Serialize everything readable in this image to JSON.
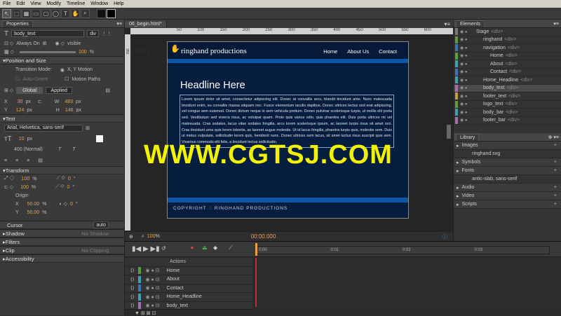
{
  "menu": [
    "File",
    "Edit",
    "View",
    "Modify",
    "Timeline",
    "Window",
    "Help"
  ],
  "properties": {
    "tab": "Properties",
    "element_name": "body_text",
    "element_tag": "div",
    "overflow": "Always On",
    "visibility": "visible",
    "opacity": "100",
    "opacity_unit": "%",
    "sections": {
      "position": "Position and Size",
      "text": "Text",
      "transform": "Transform",
      "cursor": "Cursor",
      "shadow": "Shadow",
      "filters": "Filters",
      "clip": "Clip",
      "accessibility": "Accessibility"
    },
    "transition_label": "Transition Mode:",
    "transition_xy": "X, Y Motion",
    "auto_orient": "Auto-Orient",
    "motion_paths": "Motion Paths",
    "global_tab": "Global",
    "applied_tab": "Applied",
    "x_label": "X",
    "x_val": "30",
    "x_unit": "px",
    "y_label": "Y",
    "y_val": "124",
    "y_unit": "px",
    "w_label": "W",
    "w_val": "483",
    "w_unit": "px",
    "h_label": "H",
    "h_val": "146",
    "h_unit": "px",
    "font": "Arial, Helvetica, sans-serif",
    "font_size": "10",
    "font_size_unit": "px",
    "font_weight": "400 (Normal)",
    "scale_x": "100",
    "scale_y": "100",
    "scale_unit": "%",
    "skew_x": "0",
    "skew_y": "0",
    "skew_unit": "°",
    "origin_label": "Origin",
    "origin_x": "50.00",
    "origin_y": "50.00",
    "origin_unit": "%",
    "rotate": "0",
    "cursor_value": "auto",
    "shadow_value": "No Shadow",
    "clip_value": "No Clipping"
  },
  "stage": {
    "file_tab": "06_begin.html*",
    "zoom": "100",
    "zoom_unit": "%",
    "time": "00:00.000",
    "ruler_ticks": [
      "50",
      "100",
      "150",
      "200",
      "250",
      "300",
      "350",
      "400",
      "450",
      "500",
      "550",
      "600"
    ],
    "left_ticks": [
      "50",
      "100",
      "150",
      "200",
      "250",
      "300",
      "350"
    ],
    "site": {
      "logo": "ringhand productions",
      "nav": [
        "Home",
        "About Us",
        "Contact"
      ],
      "headline": "Headline Here",
      "body": "Lorem ipsum dolor sit amet, consectetur adipiscing elit. Donec at convallis arcu, blandit tincidunt ante. Nunc malesuada tincidunt enim, eu convallis massa aliquam nec. Fusce elementum iaculis dapibus. Donec ultrices lectus sed erat adipiscing, vel congue sem euismod. Donec dictum neque in sem vehicula pretium. Donec pulvinar scelerisque turpis, ut mollis elit porta sed. Vestibulum sed viverra risus, ac volutpat quam. Proin quis varius odio, quis pharetra elit. Duis porta ultrices mi vel malesuada. Cras sodales, lacus vitae sodales fringilla, arcu lorem scelerisque ipsum, ac laoreet turpis risus sit amet orci. Cras tincidunt urna quis lorem lobortis, ac laoreet augue molestie. Ut id lacus fringilla, pharetra turpis quis, molestie sem. Duis ut metus vulputate, sollicitudin lorem quis, hendrerit nunc. Donec ultrices sem lacus, sit amet luctus risus suscipit quis sem. Vivamus commodo elit felis, a tincidunt lectus sollicitudin.",
      "copyright": "COPYRIGHT :: RINGHAND PRODUCTIONS"
    }
  },
  "elements": {
    "tab": "Elements",
    "rows": [
      {
        "label": "Stage",
        "tag": "<div>",
        "color": "#777777",
        "indent": 0
      },
      {
        "label": "ringhand",
        "tag": "<div>",
        "color": "#5aa03a",
        "indent": 1
      },
      {
        "label": "navigation",
        "tag": "<div>",
        "color": "#4070c0",
        "indent": 1
      },
      {
        "label": "Home",
        "tag": "<div>",
        "color": "#5aa03a",
        "indent": 2
      },
      {
        "label": "About",
        "tag": "<div>",
        "color": "#3fa0b0",
        "indent": 2
      },
      {
        "label": "Contact",
        "tag": "<div>",
        "color": "#4070c0",
        "indent": 2
      },
      {
        "label": "Home_Headline",
        "tag": "<div>",
        "color": "#3fa0b0",
        "indent": 1
      },
      {
        "label": "body_text",
        "tag": "<div>",
        "color": "#a070b0",
        "indent": 1
      },
      {
        "label": "footer_text",
        "tag": "<div>",
        "color": "#c0a030",
        "indent": 1
      },
      {
        "label": "logo_text",
        "tag": "<div>",
        "color": "#5aa03a",
        "indent": 1
      },
      {
        "label": "body_bar",
        "tag": "<div>",
        "color": "#3fa0b0",
        "indent": 1
      },
      {
        "label": "footer_bar",
        "tag": "<div>",
        "color": "#a070b0",
        "indent": 1
      }
    ]
  },
  "library": {
    "tab": "Library",
    "rows": [
      {
        "label": "Images",
        "group": true
      },
      {
        "label": "ringhand.svg",
        "group": false
      },
      {
        "label": "Symbols",
        "group": true
      },
      {
        "label": "Fonts",
        "group": true
      },
      {
        "label": "antic-slab, sans-serif",
        "group": false
      },
      {
        "label": "Audio",
        "group": true
      },
      {
        "label": "Video",
        "group": true
      },
      {
        "label": "Scripts",
        "group": true
      }
    ]
  },
  "timeline": {
    "actions_label": "Actions",
    "ticks": [
      "0:00",
      "0:01",
      "0:02",
      "0:03"
    ],
    "rows": [
      {
        "label": "Home",
        "color": "#5aa03a"
      },
      {
        "label": "About",
        "color": "#3fa0b0"
      },
      {
        "label": "Contact",
        "color": "#4070c0"
      },
      {
        "label": "Home_Headline",
        "color": "#3fa0b0"
      },
      {
        "label": "body_text",
        "color": "#a070b0"
      }
    ]
  },
  "watermark": "WWW.CGTSJ.COM"
}
